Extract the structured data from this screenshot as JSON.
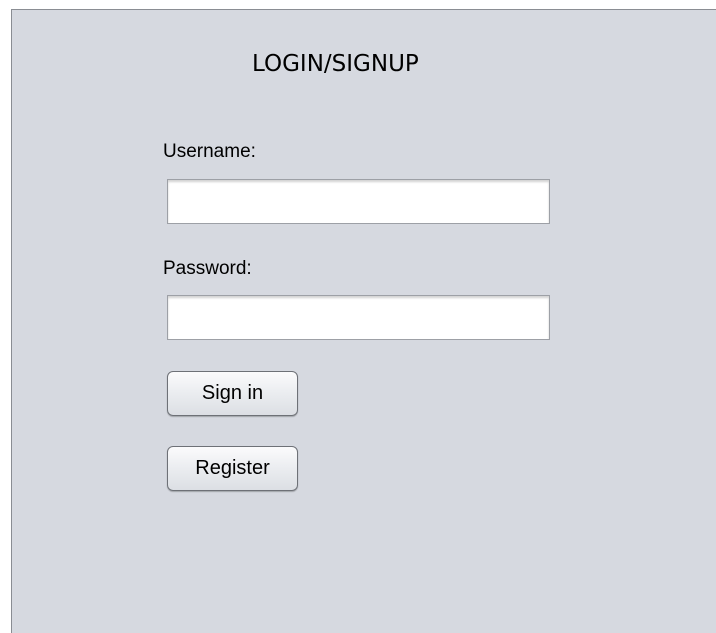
{
  "form": {
    "title": "LOGIN/SIGNUP",
    "username_label": "Username:",
    "username_value": "",
    "password_label": "Password:",
    "password_value": "",
    "signin_label": "Sign in",
    "register_label": "Register"
  },
  "colors": {
    "panel_background": "#d6d9e0",
    "field_background": "#ffffff",
    "button_border": "#6e7177"
  }
}
